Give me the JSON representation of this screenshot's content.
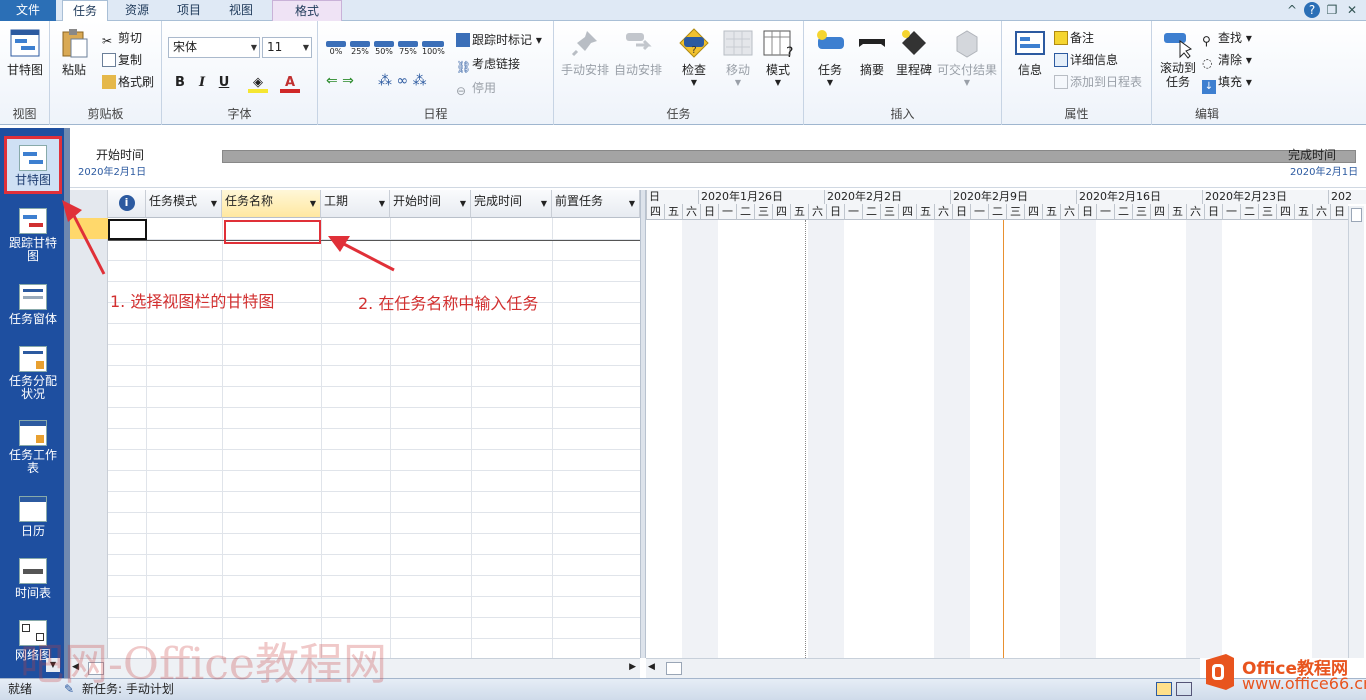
{
  "tabs": [
    {
      "label": "文件",
      "left": 0
    },
    {
      "label": "任务"
    },
    {
      "label": "资源"
    },
    {
      "label": "项目"
    },
    {
      "label": "视图"
    },
    {
      "label": "格式"
    }
  ],
  "ribbon": {
    "view_group": {
      "name": "视图",
      "gantt_label": "甘特图"
    },
    "clipboard": {
      "name": "剪贴板",
      "paste": "粘贴",
      "cut": "剪切",
      "copy": "复制",
      "format_painter": "格式刷"
    },
    "font": {
      "name": "字体",
      "family": "宋体",
      "size": "11",
      "bold": "B",
      "italic": "I",
      "underline": "U",
      "color": "A"
    },
    "schedule": {
      "name": "日程",
      "pct": [
        "0%",
        "25%",
        "50%",
        "75%",
        "100%"
      ],
      "track": "跟踪时标记",
      "respect_links": "考虑链接",
      "inactivate": "停用"
    },
    "tasks": {
      "name": "任务",
      "manual": "手动安排",
      "auto": "自动安排",
      "inspect": "检查",
      "move": "移动",
      "mode": "模式"
    },
    "insert": {
      "name": "插入",
      "task": "任务",
      "summary": "摘要",
      "milestone": "里程碑",
      "deliverable": "可交付结果"
    },
    "properties": {
      "name": "属性",
      "info": "信息",
      "notes": "备注",
      "details": "详细信息",
      "add_timeline": "添加到日程表"
    },
    "editing": {
      "name": "编辑",
      "scroll": "滚动到",
      "scroll2": "任务",
      "find": "查找",
      "clear": "清除",
      "fill": "填充"
    }
  },
  "nav": [
    {
      "label": "甘特图",
      "icon": "gantt-icon"
    },
    {
      "label": "跟踪甘特图",
      "icon": "tracking-gantt-icon"
    },
    {
      "label": "任务窗体",
      "icon": "task-form-icon"
    },
    {
      "label": "任务分配状况",
      "icon": "task-usage-icon"
    },
    {
      "label": "任务工作表",
      "icon": "task-sheet-icon"
    },
    {
      "label": "日历",
      "icon": "calendar-icon"
    },
    {
      "label": "时间表",
      "icon": "timeline-icon"
    },
    {
      "label": "网络图",
      "icon": "network-icon"
    }
  ],
  "timeline": {
    "start_label": "开始时间",
    "start_date": "2020年2月1日",
    "end_label": "完成时间",
    "end_date": "2020年2月1日"
  },
  "columns": [
    "任务模式",
    "任务名称",
    "工期",
    "开始时间",
    "完成时间",
    "前置任务"
  ],
  "weeks": [
    "日",
    "2020年1月26日",
    "2020年2月2日",
    "2020年2月9日",
    "2020年2月16日",
    "2020年2月23日",
    "202"
  ],
  "days": [
    "四",
    "五",
    "六",
    "日",
    "一",
    "二",
    "三",
    "四",
    "五",
    "六",
    "日",
    "一",
    "二",
    "三",
    "四",
    "五",
    "六",
    "日",
    "一",
    "二",
    "三",
    "四",
    "五",
    "六",
    "日",
    "一",
    "二",
    "三",
    "四",
    "五",
    "六",
    "日",
    "一",
    "二",
    "三",
    "四",
    "五",
    "六",
    "日"
  ],
  "annotations": {
    "step1": "1. 选择视图栏的甘特图",
    "step2": "2. 在任务名称中输入任务"
  },
  "status": {
    "ready": "就绪",
    "new_task": "新任务: 手动计划"
  },
  "watermark": "吧网-Office教程网",
  "logo": {
    "line1": "Office教程网",
    "line2": "www.office66.cn"
  }
}
